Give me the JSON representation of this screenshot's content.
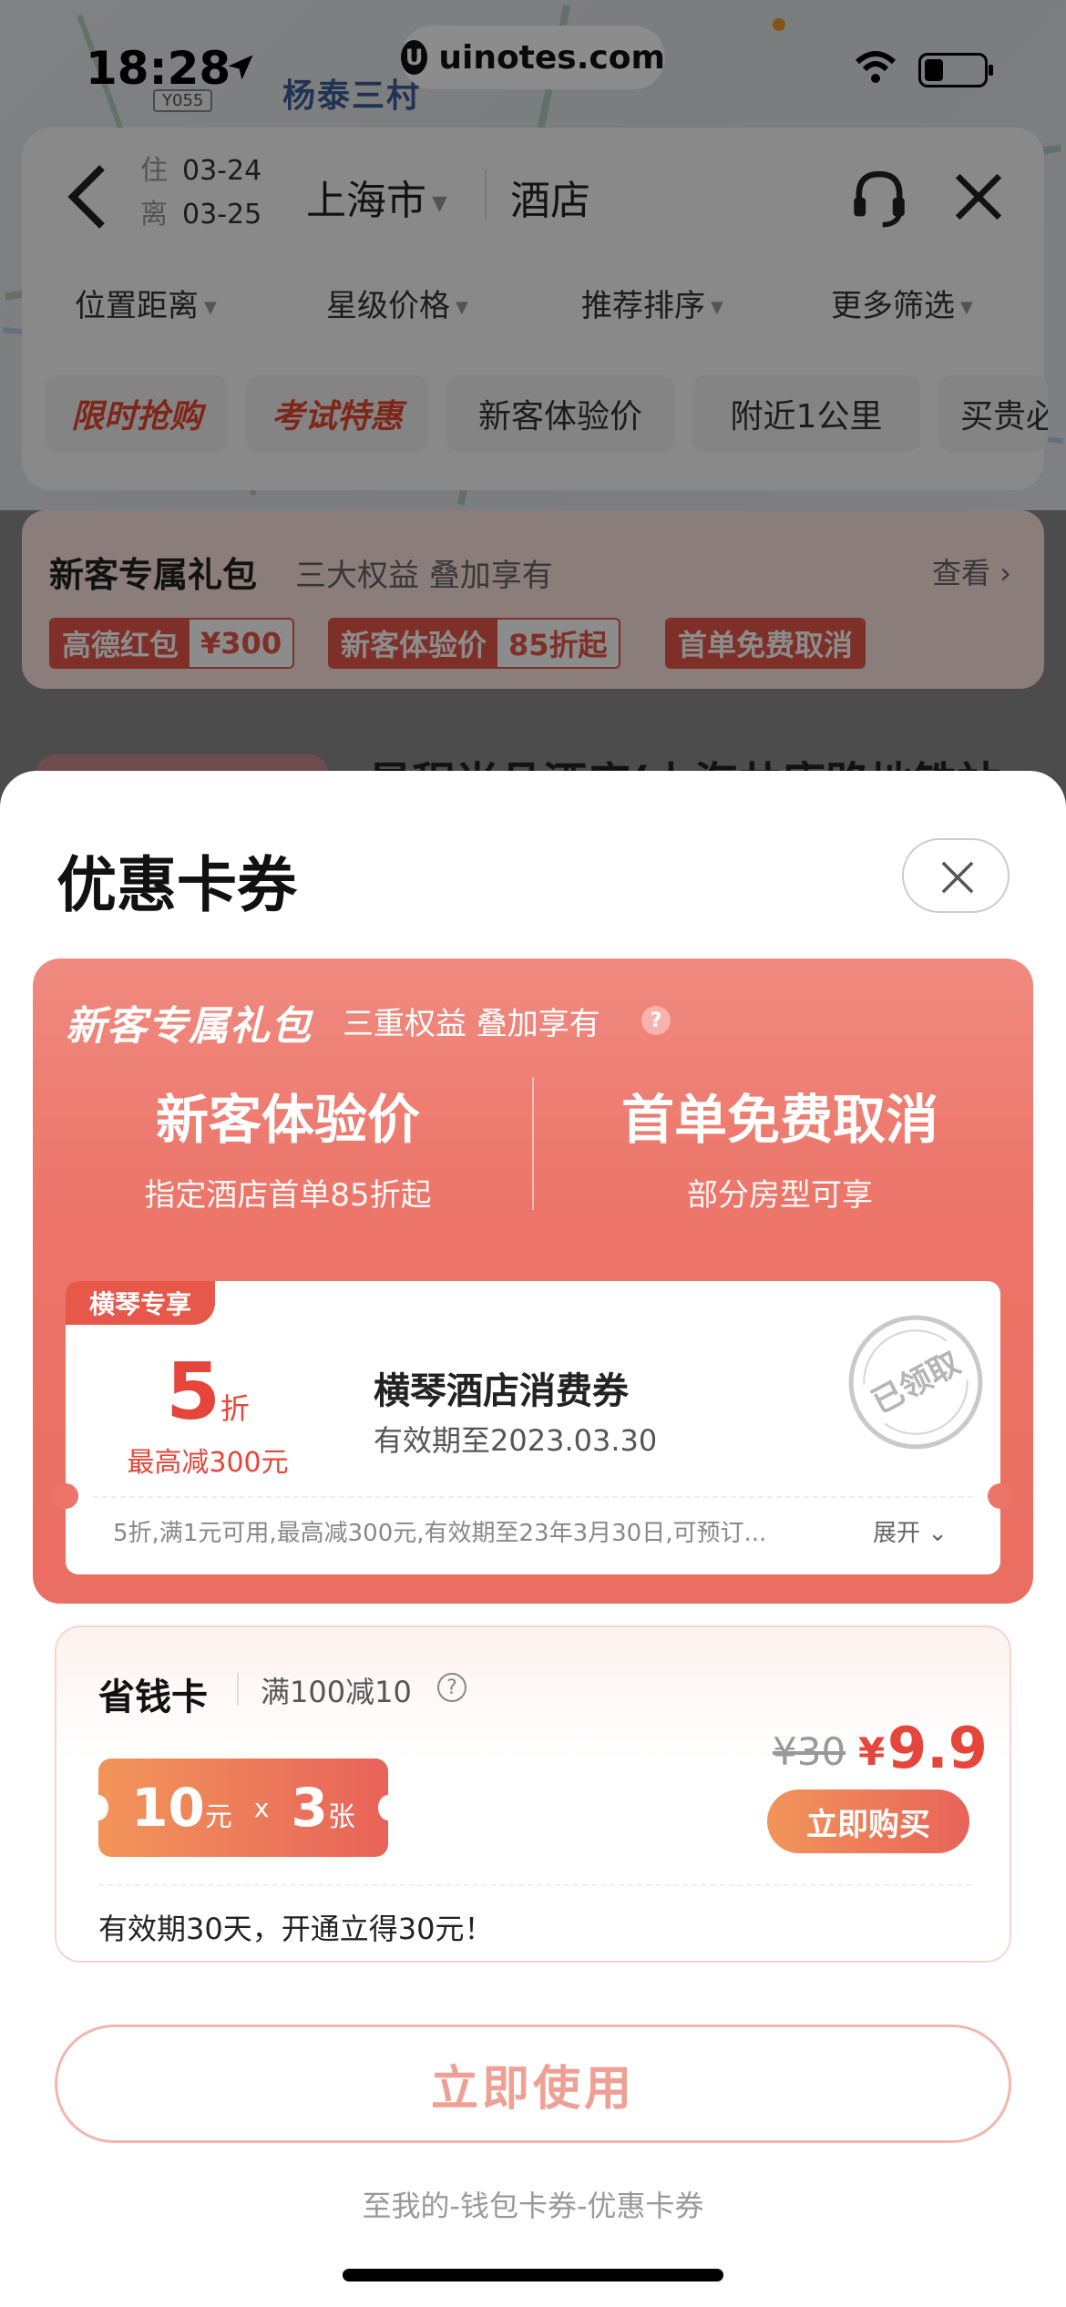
{
  "status_bar": {
    "time": "18:28",
    "plate": "Y055",
    "brand": "uinotes.com",
    "brand_logo": "U"
  },
  "map": {
    "label": "杨泰三村"
  },
  "header": {
    "checkin_label": "住",
    "checkin_date": "03-24",
    "checkout_label": "离",
    "checkout_date": "03-25",
    "city": "上海市",
    "keyword": "酒店"
  },
  "filters": [
    "位置距离",
    "星级价格",
    "推荐排序",
    "更多筛选"
  ],
  "chips": [
    {
      "label": "限时抢购",
      "hot": true
    },
    {
      "label": "考试特惠",
      "hot": true
    },
    {
      "label": "新客体验价",
      "hot": false
    },
    {
      "label": "附近1公里",
      "hot": false
    },
    {
      "label": "买贵必",
      "hot": false
    }
  ],
  "gift_banner": {
    "title": "新客专属礼包",
    "subtitle": "三大权益 叠加享有",
    "view": "查看",
    "tags": [
      {
        "a": "高德红包",
        "b": "¥300"
      },
      {
        "a": "新客体验价",
        "b": "85折起"
      },
      {
        "a": "首单免费取消",
        "b": ""
      }
    ]
  },
  "hotel_peek": {
    "name": "星程尚品酒店(上海共康路地铁站"
  },
  "sheet": {
    "title": "优惠卡券",
    "packet": {
      "title": "新客专属礼包",
      "subtitle": "三重权益 叠加享有",
      "benefits": [
        {
          "title": "新客体验价",
          "sub": "指定酒店首单85折起"
        },
        {
          "title": "首单免费取消",
          "sub": "部分房型可享"
        }
      ],
      "coupon": {
        "tag": "横琴专享",
        "discount": "5",
        "discount_unit": "折",
        "max": "最高减300元",
        "name": "横琴酒店消费券",
        "valid": "有效期至2023.03.30",
        "stamp": "已领取",
        "desc": "5折,满1元可用,最高减300元,有效期至23年3月30日,可预订...",
        "expand": "展开"
      }
    },
    "saver": {
      "title": "省钱卡",
      "condition": "满100减10",
      "ticket_amount": "10",
      "ticket_unit": "元",
      "ticket_x": "x",
      "ticket_count": "3",
      "ticket_count_unit": "张",
      "price_old": "¥30",
      "price_symbol": "¥",
      "price_new": "9.9",
      "buy": "立即购买",
      "note": "有效期30天，开通立得30元！"
    },
    "use_button": "立即使用",
    "path_hint": "至我的-钱包卡券-优惠卡券"
  },
  "colors": {
    "accent": "#e5584a",
    "packet": "#ec7468",
    "price": "#e5453a"
  }
}
